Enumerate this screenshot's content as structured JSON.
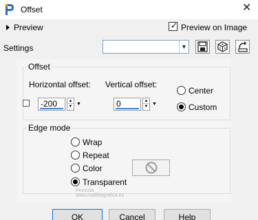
{
  "window": {
    "title": "Offset",
    "close_glyph": "✕"
  },
  "preview": {
    "label": "Preview",
    "preview_on_image_label": "Preview on Image",
    "preview_on_image_checked": true
  },
  "settings": {
    "label": "Settings",
    "value": ""
  },
  "offset_group": {
    "title": "Offset",
    "horizontal_label": "Horizontal offset:",
    "horizontal_value": "-200",
    "vertical_label": "Vertical offset:",
    "vertical_value": "0",
    "mode_options": [
      {
        "label": "Center",
        "selected": false
      },
      {
        "label": "Custom",
        "selected": true
      }
    ]
  },
  "edge_group": {
    "title": "Edge mode",
    "options": [
      {
        "label": "Wrap",
        "selected": false
      },
      {
        "label": "Repeat",
        "selected": false
      },
      {
        "label": "Color",
        "selected": false
      },
      {
        "label": "Transparent",
        "selected": true
      }
    ]
  },
  "watermark": {
    "line1": "Pinuccia",
    "line2": "www.maldiregrafica.eu"
  },
  "buttons": {
    "ok": "OK",
    "cancel": "Cancel",
    "help": "Help"
  },
  "colors": {
    "accent": "#0078d7",
    "input_underline": "#3b7fd6"
  }
}
